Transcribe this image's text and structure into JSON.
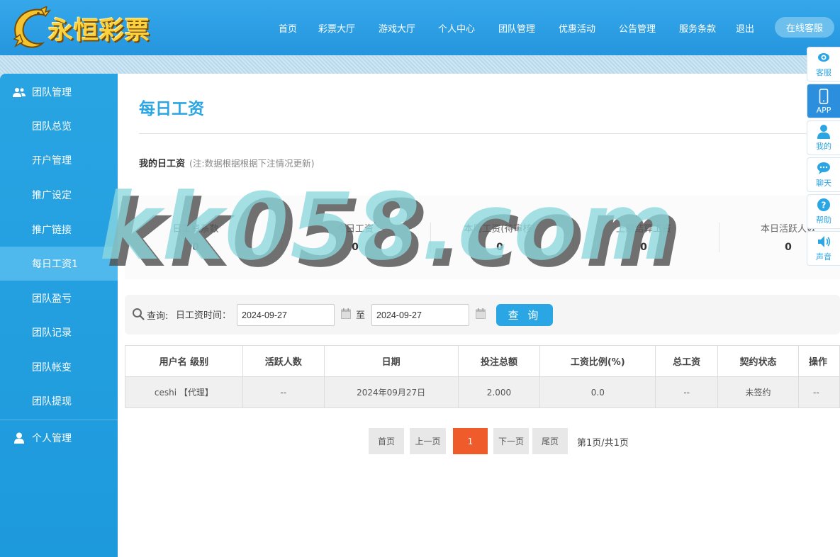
{
  "header": {
    "logo_text": "永恒彩票",
    "nav": [
      "首页",
      "彩票大厅",
      "游戏大厅",
      "个人中心",
      "团队管理",
      "优惠活动",
      "公告管理",
      "服务条款",
      "退出"
    ],
    "online_service": "在线客服"
  },
  "sidebar": {
    "team_header": "团队管理",
    "items": [
      "团队总览",
      "开户管理",
      "推广设定",
      "推广链接",
      "每日工资1",
      "团队盈亏",
      "团队记录",
      "团队帐变",
      "团队提现"
    ],
    "active_index": 4,
    "personal_header": "个人管理"
  },
  "main": {
    "title": "每日工资",
    "my_salary_label": "我的日工资",
    "my_salary_note": "(注:数据根据根据下注情况更新)",
    "stats": [
      {
        "label": "日工资系数",
        "value": "0"
      },
      {
        "label": "今日工资",
        "value": "0"
      },
      {
        "label": "本周工资(待审核)",
        "value": "0"
      },
      {
        "label": "上期结算工资",
        "value": "0"
      },
      {
        "label": "本日活跃人数",
        "value": "0"
      }
    ],
    "search": {
      "query_label": "查询:",
      "time_label": "日工资时间：",
      "date_from": "2024-09-27",
      "to_label": "至",
      "date_to": "2024-09-27",
      "button": "查 询"
    },
    "table": {
      "headers": [
        "用户名 级别",
        "活跃人数",
        "日期",
        "投注总额",
        "工资比例(%)",
        "总工资",
        "契约状态",
        "操作"
      ],
      "rows": [
        [
          "ceshi 【代理】",
          "--",
          "2024年09月27日",
          "2.000",
          "0.0",
          "--",
          "未签约",
          "--"
        ]
      ]
    },
    "pager": {
      "first": "首页",
      "prev": "上一页",
      "current": "1",
      "next": "下一页",
      "last": "尾页",
      "info": "第1页/共1页"
    }
  },
  "float_bar": [
    "客服",
    "APP",
    "我的",
    "聊天",
    "帮助",
    "声音"
  ],
  "watermark": "kk058.com",
  "colors": {
    "header": "#2596de",
    "accent": "#2ba6e4",
    "sidebar": "#1d9adc",
    "active_page": "#ef5b2b"
  }
}
